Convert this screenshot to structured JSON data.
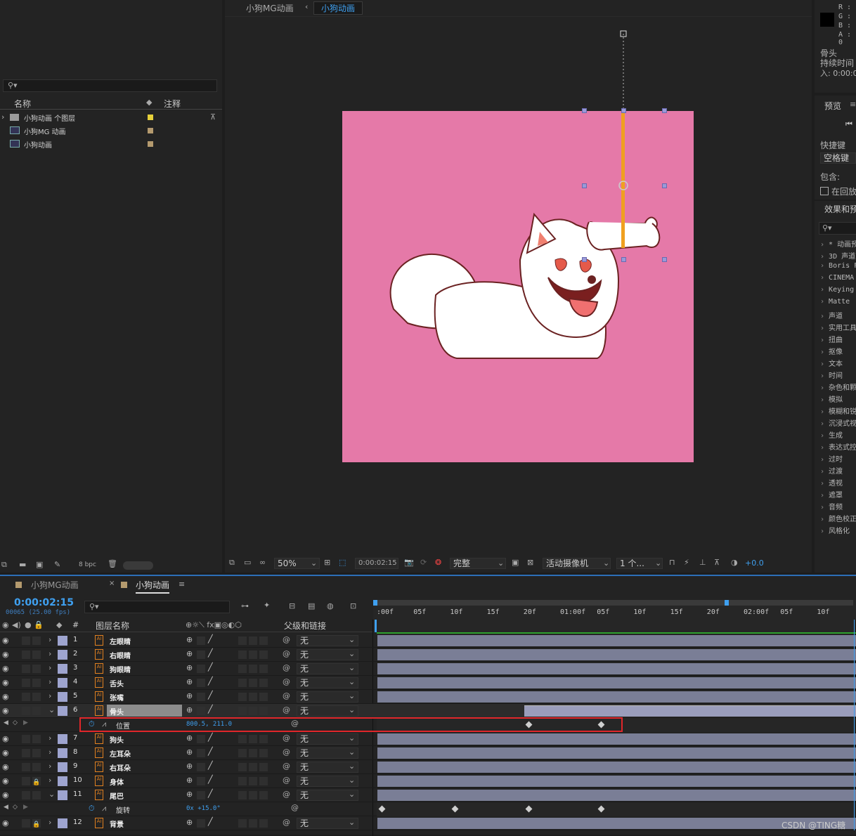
{
  "project": {
    "search_placeholder": "",
    "col_name": "名称",
    "col_note": "注释",
    "items": [
      {
        "label": "小狗动画 个图层",
        "swatch": "#e6d03a"
      },
      {
        "label": "小狗MG 动画",
        "swatch": "#b49a6e"
      },
      {
        "label": "小狗动画",
        "swatch": "#b49a6e"
      }
    ],
    "bpc": "8 bpc"
  },
  "comp": {
    "crumb1": "小狗MG动画",
    "crumb2": "小狗动画",
    "zoom": "50%",
    "time": "0:00:02:15",
    "quality": "完整",
    "camera": "活动摄像机",
    "views": "1 个...",
    "exposure": "+0.0"
  },
  "info": {
    "r": "R :",
    "g": "G :",
    "b": "B :",
    "a": "A : 0",
    "layer": "骨头",
    "duration": "持续时间",
    "in": "入: 0:00:0"
  },
  "preview": {
    "title": "预览",
    "shortcut_label": "快捷键",
    "shortcut": "空格键",
    "include": "包含:",
    "loop": "在回放"
  },
  "effects": {
    "title": "效果和预",
    "items": [
      "* 动画预",
      "3D 声道",
      "Boris FX",
      "CINEMA 4",
      "Keying",
      "Matte",
      "声道",
      "实用工具",
      "扭曲",
      "抠像",
      "文本",
      "时间",
      "杂色和颗",
      "模拟",
      "模糊和锐",
      "沉浸式视",
      "生成",
      "表达式控",
      "过时",
      "过渡",
      "透视",
      "遮罩",
      "音频",
      "颜色校正",
      "风格化"
    ]
  },
  "timeline": {
    "tab1": "小狗MG动画",
    "tab2": "小狗动画",
    "time": "0:00:02:15",
    "frames": "00065 (25.00 fps)",
    "col_num": "#",
    "col_name": "图层名称",
    "col_parent": "父级和链接",
    "ruler": [
      ":00f",
      "05f",
      "10f",
      "15f",
      "20f",
      "01:00f",
      "05f",
      "10f",
      "15f",
      "20f",
      "02:00f",
      "05f",
      "10f"
    ],
    "layers": [
      {
        "n": "1",
        "name": "左眼睛",
        "parent": "无"
      },
      {
        "n": "2",
        "name": "右眼睛",
        "parent": "无"
      },
      {
        "n": "3",
        "name": "狗眼睛",
        "parent": "无"
      },
      {
        "n": "4",
        "name": "舌头",
        "parent": "无"
      },
      {
        "n": "5",
        "name": "张嘴",
        "parent": "无"
      },
      {
        "n": "6",
        "name": "骨头",
        "parent": "无"
      },
      {
        "n": "7",
        "name": "狗头",
        "parent": "无"
      },
      {
        "n": "8",
        "name": "左耳朵",
        "parent": "无"
      },
      {
        "n": "9",
        "name": "右耳朵",
        "parent": "无"
      },
      {
        "n": "10",
        "name": "身体",
        "parent": "无"
      },
      {
        "n": "11",
        "name": "尾巴",
        "parent": "无"
      },
      {
        "n": "12",
        "name": "背景",
        "parent": "无"
      }
    ],
    "prop_position": {
      "name": "位置",
      "value": "800.5, 211.0"
    },
    "prop_rotation": {
      "name": "旋转",
      "value": "0x +15.0°"
    },
    "watermark": "CSDN @TING糖"
  }
}
